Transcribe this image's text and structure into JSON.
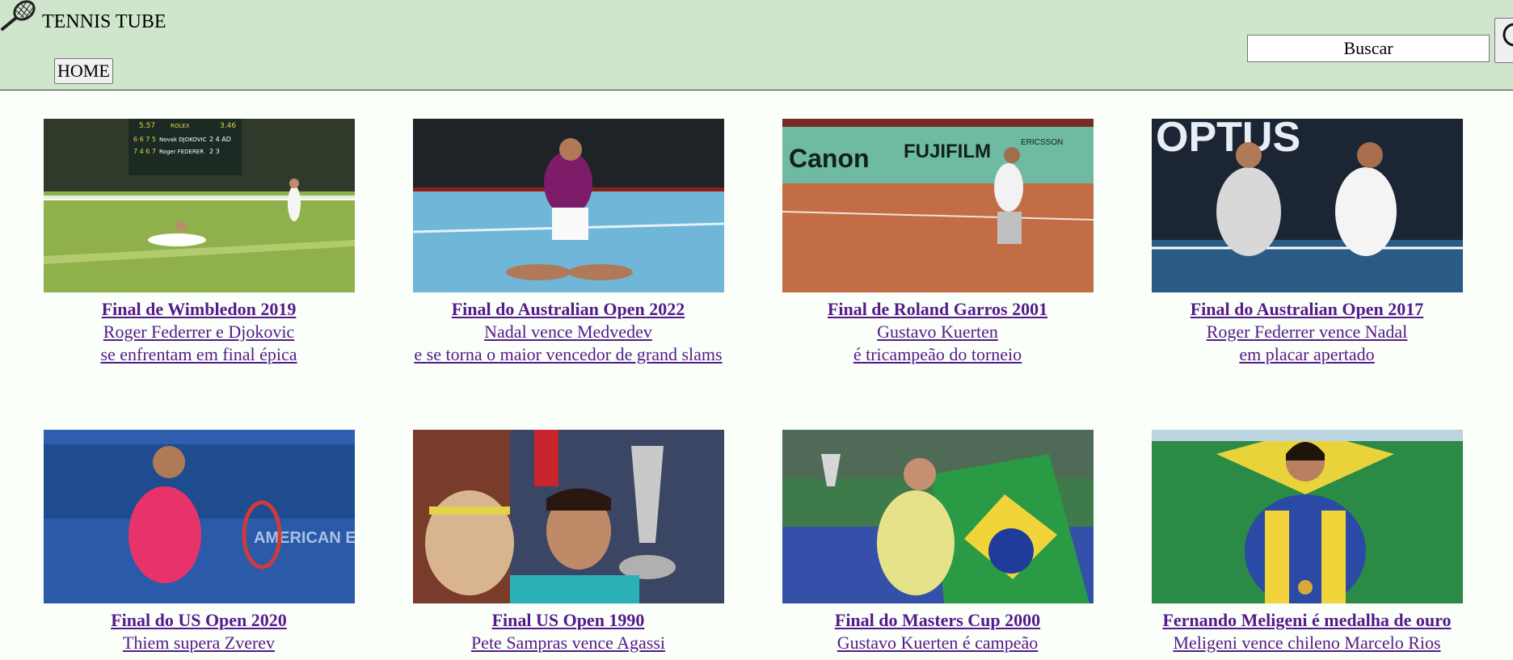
{
  "header": {
    "site_title": "TENNIS TUBE",
    "logo_icon": "tennis-racket-icon",
    "nav_home_label": "HOME",
    "search_placeholder": "Buscar",
    "search_button_icon": "search-magnifier-icon",
    "background_color": "#cfe5cc"
  },
  "link_color": "#551a8b",
  "videos": [
    {
      "title": "Final de Wimbledon 2019",
      "line1": "Roger Federrer e Djokovic",
      "line2": "se enfrentam em final épica",
      "image": "wimbledon-grass-court-photo",
      "scoreboard": [
        "5.57",
        "ROLEX",
        "3.46",
        "Novak DJOKOVIC",
        "6 6 7 5",
        "2 4 AD",
        "Roger FEDERER",
        "7 4 6 7",
        "2 3"
      ]
    },
    {
      "title": "Final do Australian Open 2022",
      "line1": "Nadal vence Medvedev",
      "line2": "e se torna o maior vencedor de grand slams",
      "image": "player-kneeling-hard-court-photo"
    },
    {
      "title": "Final de Roland Garros 2001",
      "line1": "Gustavo Kuerten",
      "line2": "é tricampeão do torneio",
      "image": "player-kneeling-clay-court-photo",
      "banner_text": [
        "Canon",
        "FUJIFILM",
        "ERICSSON"
      ]
    },
    {
      "title": "Final do Australian Open 2017",
      "line1": "Roger Federrer vence Nadal",
      "line2": "em placar apertado",
      "image": "players-handshake-net-photo",
      "banner_text": [
        "OPTUS"
      ]
    },
    {
      "title": "Final do US Open 2020",
      "line1": "Thiem supera Zverev",
      "line2": "",
      "image": "player-celebrating-pink-shirt-photo",
      "banner_text": [
        "AMERICAN EXPRESS"
      ]
    },
    {
      "title": "Final US Open 1990",
      "line1": "Pete Sampras vence Agassi",
      "line2": "",
      "image": "player-holding-trophy-photo"
    },
    {
      "title": "Final do Masters Cup 2000",
      "line1": "Gustavo Kuerten é campeão",
      "line2": "",
      "image": "player-with-brazil-flag-photo"
    },
    {
      "title": "Fernando Meligeni é medalha de ouro",
      "line1": "Meligeni vence chileno Marcelo Rios",
      "line2": "",
      "image": "player-with-gold-medal-photo"
    }
  ]
}
